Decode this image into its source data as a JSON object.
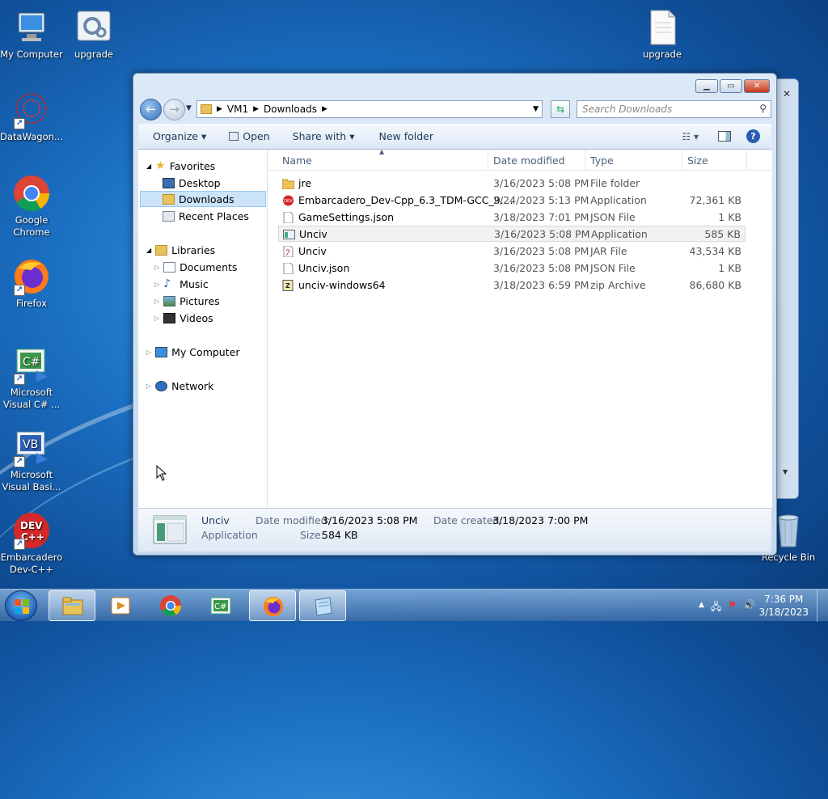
{
  "desktop": {
    "icons": [
      {
        "label": "My Computer"
      },
      {
        "label": "upgrade"
      },
      {
        "label": "upgrade"
      },
      {
        "label": "DataWagon..."
      },
      {
        "label": "Google Chrome"
      },
      {
        "label": "Firefox"
      },
      {
        "label": "Microsoft Visual C# ..."
      },
      {
        "label": "Microsoft Visual Basi..."
      },
      {
        "label": "Embarcadero Dev-C++"
      },
      {
        "label": "Recycle Bin"
      }
    ]
  },
  "explorer": {
    "breadcrumb": [
      "VM1",
      "Downloads"
    ],
    "search_placeholder": "Search Downloads",
    "toolbar": {
      "organize": "Organize",
      "open": "Open",
      "share_with": "Share with",
      "new_folder": "New folder"
    },
    "nav": {
      "favorites": "Favorites",
      "desktop": "Desktop",
      "downloads": "Downloads",
      "recent_places": "Recent Places",
      "libraries": "Libraries",
      "documents": "Documents",
      "music": "Music",
      "pictures": "Pictures",
      "videos": "Videos",
      "my_computer": "My Computer",
      "network": "Network"
    },
    "columns": {
      "name": "Name",
      "date": "Date modified",
      "type": "Type",
      "size": "Size"
    },
    "files": [
      {
        "name": "jre",
        "date": "3/16/2023 5:08 PM",
        "type": "File folder",
        "size": ""
      },
      {
        "name": "Embarcadero_Dev-Cpp_6.3_TDM-GCC_9....",
        "date": "2/24/2023 5:13 PM",
        "type": "Application",
        "size": "72,361 KB"
      },
      {
        "name": "GameSettings.json",
        "date": "3/18/2023 7:01 PM",
        "type": "JSON File",
        "size": "1 KB"
      },
      {
        "name": "Unciv",
        "date": "3/16/2023 5:08 PM",
        "type": "Application",
        "size": "585 KB"
      },
      {
        "name": "Unciv",
        "date": "3/16/2023 5:08 PM",
        "type": "JAR File",
        "size": "43,534 KB"
      },
      {
        "name": "Unciv.json",
        "date": "3/16/2023 5:08 PM",
        "type": "JSON File",
        "size": "1 KB"
      },
      {
        "name": "unciv-windows64",
        "date": "3/18/2023 6:59 PM",
        "type": "zip Archive",
        "size": "86,680 KB"
      }
    ],
    "details": {
      "name": "Unciv",
      "type": "Application",
      "date_modified_label": "Date modified:",
      "date_modified": "3/16/2023 5:08 PM",
      "date_created_label": "Date created:",
      "date_created": "3/18/2023 7:00 PM",
      "size_label": "Size:",
      "size": "584 KB"
    }
  },
  "taskbar": {
    "time": "7:36 PM",
    "date": "3/18/2023"
  }
}
